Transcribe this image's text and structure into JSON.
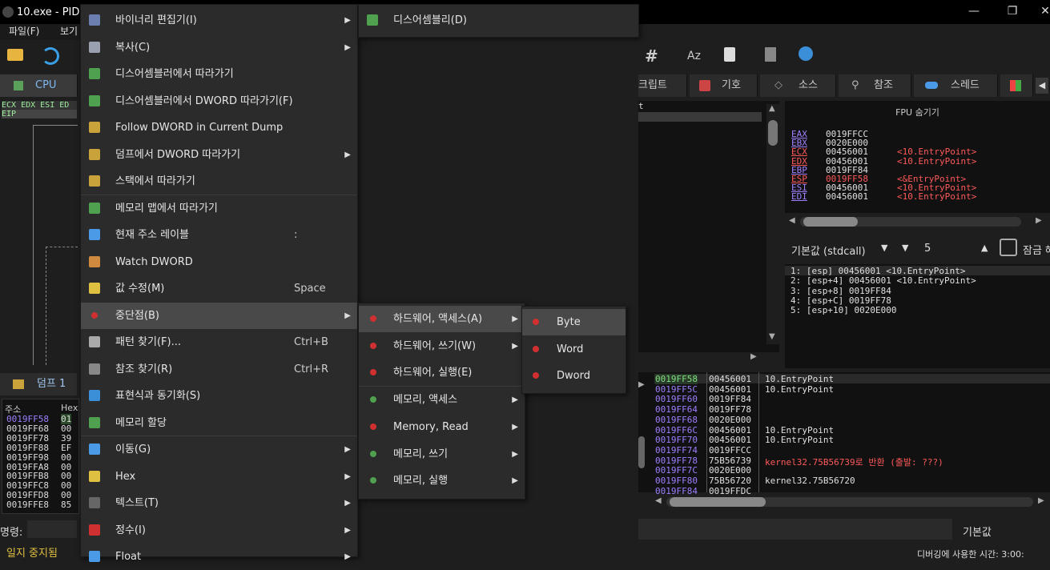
{
  "window": {
    "title": "10.exe - PID:",
    "minimize": "—",
    "restore": "❐",
    "close": "✕"
  },
  "menubar": {
    "items": [
      "파일(F)",
      "보기"
    ]
  },
  "tabs": {
    "cpu": "CPU",
    "script": "크립트",
    "symbols": "기호",
    "source": "소스",
    "references": "참조",
    "threads": "스레드"
  },
  "registers_strip": {
    "line1": "ECX EDX ESI ED",
    "line2": "EIP"
  },
  "disasm_partial": "t",
  "fpu": {
    "title": "FPU 숨기기",
    "registers": [
      {
        "name": "EAX",
        "value": "0019FFCC",
        "comment": ""
      },
      {
        "name": "EBX",
        "value": "0020E000",
        "comment": ""
      },
      {
        "name": "ECX",
        "value": "00456001",
        "comment": "<10.EntryPoint>"
      },
      {
        "name": "EDX",
        "value": "00456001",
        "comment": "<10.EntryPoint>"
      },
      {
        "name": "EBP",
        "value": "0019FF84",
        "comment": ""
      },
      {
        "name": "ESP",
        "value": "0019FF58",
        "comment": "<&EntryPoint>"
      },
      {
        "name": "ESI",
        "value": "00456001",
        "comment": "<10.EntryPoint>"
      },
      {
        "name": "EDI",
        "value": "00456001",
        "comment": "<10.EntryPoint>"
      }
    ],
    "colors": {
      "changed": "#ff5a5a",
      "normal": "#e0e0e0",
      "regname": "#a080ff",
      "comment": "#ff5a5a"
    }
  },
  "call_convention": {
    "select": "기본값 (stdcall)",
    "count": "5",
    "lock_label": "잠금 해"
  },
  "stack_args": [
    "1: [esp] 00456001 <10.EntryPoint>",
    "2: [esp+4] 00456001 <10.EntryPoint>",
    "3: [esp+8] 0019FF84",
    "4: [esp+C] 0019FF78",
    "5: [esp+10] 0020E000"
  ],
  "stack": [
    {
      "addr": "0019FF58",
      "val": "00456001",
      "cmt": "10.EntryPoint"
    },
    {
      "addr": "0019FF5C",
      "val": "00456001",
      "cmt": "10.EntryPoint"
    },
    {
      "addr": "0019FF60",
      "val": "0019FF84",
      "cmt": ""
    },
    {
      "addr": "0019FF64",
      "val": "0019FF78",
      "cmt": ""
    },
    {
      "addr": "0019FF68",
      "val": "0020E000",
      "cmt": ""
    },
    {
      "addr": "0019FF6C",
      "val": "00456001",
      "cmt": "10.EntryPoint"
    },
    {
      "addr": "0019FF70",
      "val": "00456001",
      "cmt": "10.EntryPoint"
    },
    {
      "addr": "0019FF74",
      "val": "0019FFCC",
      "cmt": ""
    },
    {
      "addr": "0019FF78",
      "val": "75B56739",
      "cmt": "kernel32.75B56739로 반환 (출발: ???)"
    },
    {
      "addr": "0019FF7C",
      "val": "0020E000",
      "cmt": ""
    },
    {
      "addr": "0019FF80",
      "val": "75B56720",
      "cmt": "kernel32.75B56720"
    },
    {
      "addr": "0019FF84",
      "val": "0019FFDC",
      "cmt": ""
    }
  ],
  "dump": {
    "tab": "덤프 1",
    "header_addr": "주소",
    "header_hex": "Hex",
    "rows": [
      {
        "addr": "0019FF58",
        "hex": "01"
      },
      {
        "addr": "0019FF68",
        "hex": "00"
      },
      {
        "addr": "0019FF78",
        "hex": "39"
      },
      {
        "addr": "0019FF88",
        "hex": "EF"
      },
      {
        "addr": "0019FF98",
        "hex": "00"
      },
      {
        "addr": "0019FFA8",
        "hex": "00"
      },
      {
        "addr": "0019FFB8",
        "hex": "00"
      },
      {
        "addr": "0019FFC8",
        "hex": "00"
      },
      {
        "addr": "0019FFD8",
        "hex": "00"
      },
      {
        "addr": "0019FFE8",
        "hex": "85"
      }
    ]
  },
  "command": {
    "label": "명령:",
    "status": "일지 중지됨",
    "default_label": "기본값",
    "bottom_status": "디버깅에 사용한 시간: 3:00:"
  },
  "context_menu": {
    "items": [
      {
        "label": "바이너리 편집기(I)",
        "shortcut": "",
        "submenu": true
      },
      {
        "label": "복사(C)",
        "shortcut": "",
        "submenu": true
      },
      {
        "label": "디스어셈블러에서 따라가기",
        "shortcut": "",
        "submenu": false
      },
      {
        "label": "디스어셈블러에서 DWORD 따라가기(F)",
        "shortcut": "",
        "submenu": false
      },
      {
        "label": "Follow DWORD in Current Dump",
        "shortcut": "",
        "submenu": false
      },
      {
        "label": "덤프에서 DWORD 따라가기",
        "shortcut": "",
        "submenu": true
      },
      {
        "label": "스택에서 따라가기",
        "shortcut": "",
        "submenu": false
      },
      {
        "label": "메모리 맵에서 따라가기",
        "shortcut": "",
        "submenu": false
      },
      {
        "label": "현재 주소 레이블",
        "shortcut": ":",
        "submenu": false
      },
      {
        "label": "Watch DWORD",
        "shortcut": "",
        "submenu": false
      },
      {
        "label": "값 수정(M)",
        "shortcut": "Space",
        "submenu": false
      },
      {
        "label": "중단점(B)",
        "shortcut": "",
        "submenu": true
      },
      {
        "label": "패턴 찾기(F)...",
        "shortcut": "Ctrl+B",
        "submenu": false
      },
      {
        "label": "참조 찾기(R)",
        "shortcut": "Ctrl+R",
        "submenu": false
      },
      {
        "label": "표현식과 동기화(S)",
        "shortcut": "",
        "submenu": false
      },
      {
        "label": "메모리 할당",
        "shortcut": "",
        "submenu": false
      },
      {
        "label": "이동(G)",
        "shortcut": "",
        "submenu": true
      },
      {
        "label": "Hex",
        "shortcut": "",
        "submenu": true
      },
      {
        "label": "텍스트(T)",
        "shortcut": "",
        "submenu": true
      },
      {
        "label": "정수(I)",
        "shortcut": "",
        "submenu": true
      },
      {
        "label": "Float",
        "shortcut": "",
        "submenu": true
      }
    ],
    "selected_index": 11
  },
  "top_submenu": {
    "label": "디스어셈블리(D)"
  },
  "breakpoint_menu": {
    "items": [
      {
        "label": "하드웨어, 액세스(A)",
        "submenu": true
      },
      {
        "label": "하드웨어, 쓰기(W)",
        "submenu": true
      },
      {
        "label": "하드웨어, 실행(E)",
        "submenu": false
      },
      {
        "label": "메모리, 액세스",
        "submenu": true
      },
      {
        "label": "Memory, Read",
        "submenu": true
      },
      {
        "label": "메모리, 쓰기",
        "submenu": true
      },
      {
        "label": "메모리, 실행",
        "submenu": true
      }
    ],
    "selected_index": 0
  },
  "size_menu": {
    "items": [
      "Byte",
      "Word",
      "Dword"
    ],
    "selected_index": 0
  }
}
